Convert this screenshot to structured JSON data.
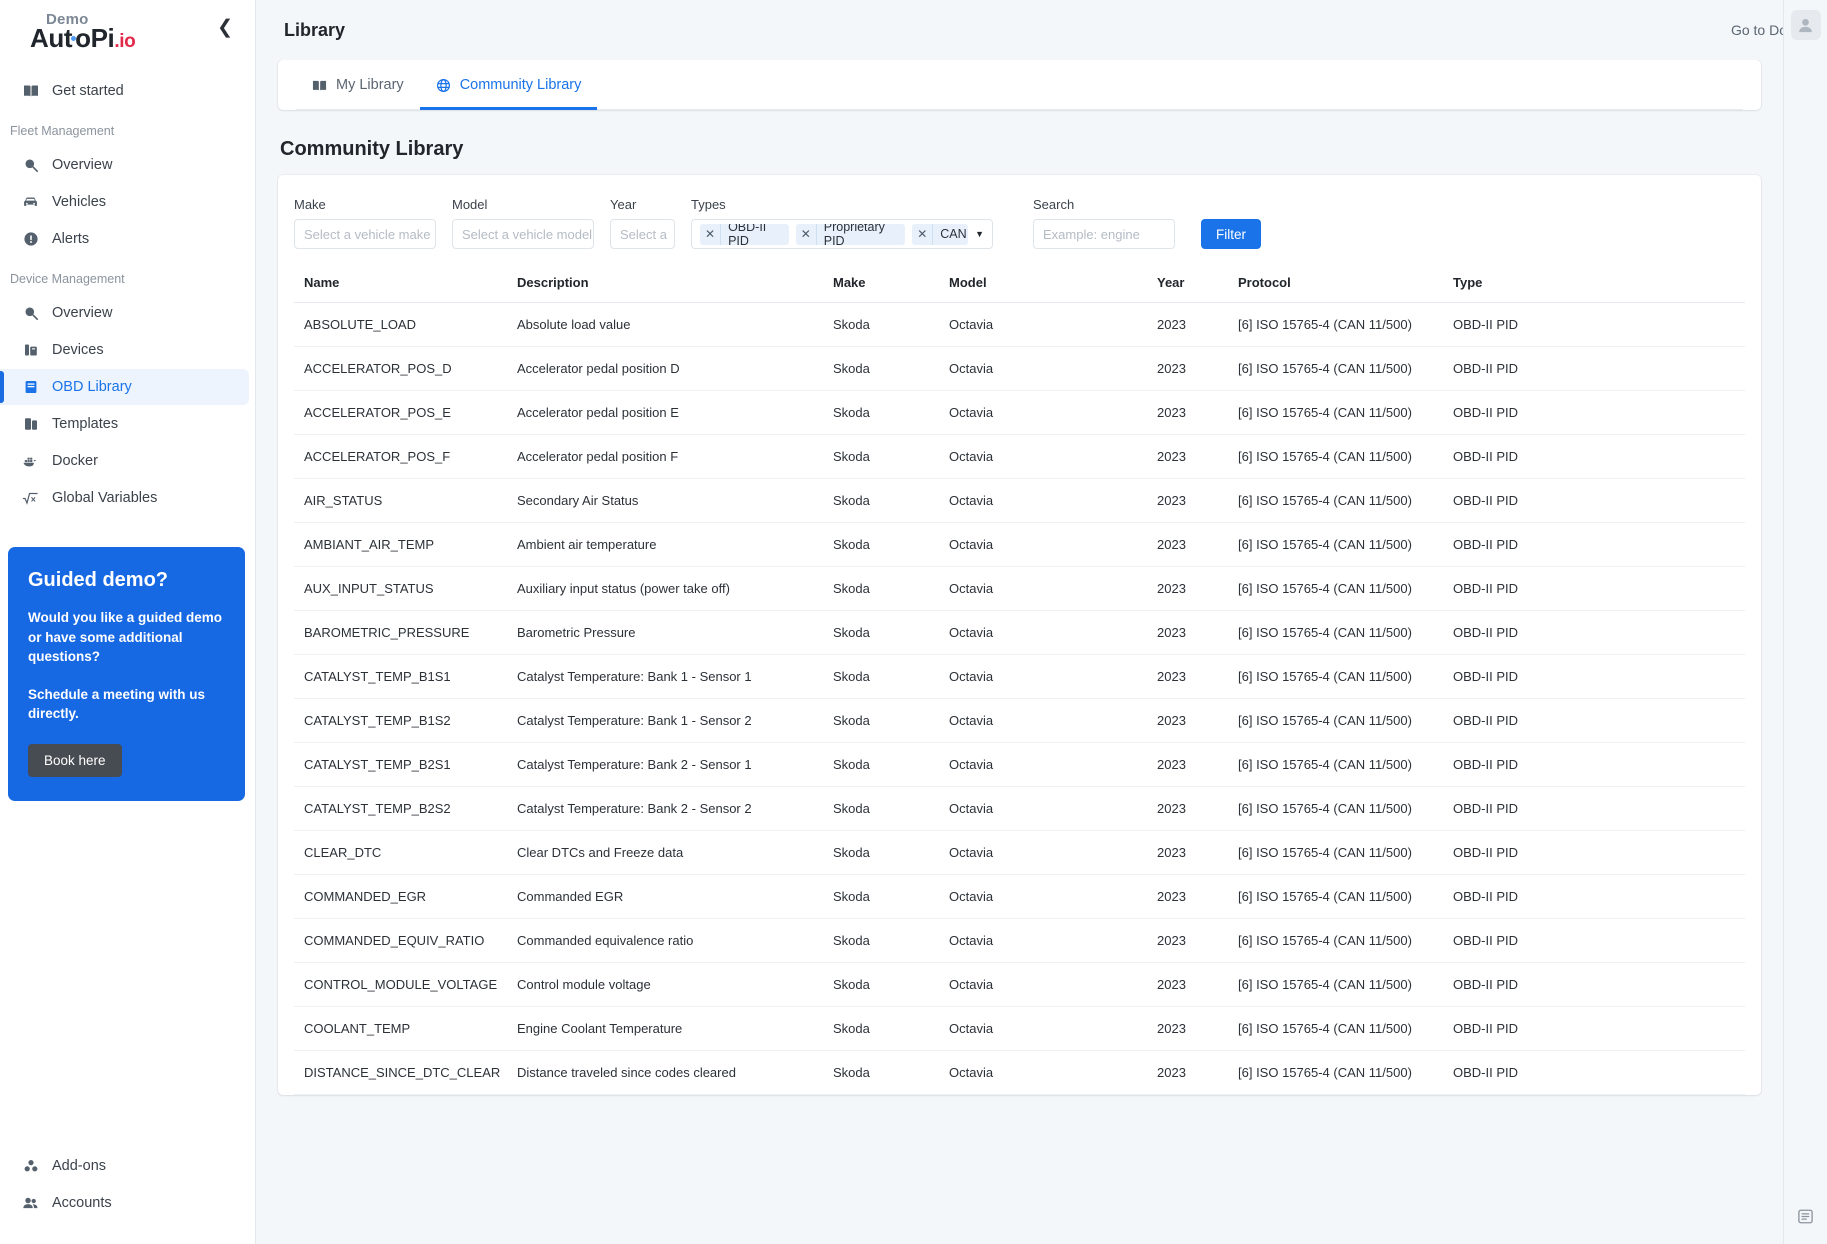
{
  "sidebar": {
    "brand": {
      "demo": "Demo",
      "name": "AutoPi",
      "suffix": ".io"
    },
    "collapse_icon": "chevron-left-icon",
    "top_items": [
      {
        "label": "Get started",
        "icon": "book-icon"
      }
    ],
    "sections": [
      {
        "label": "Fleet Management",
        "items": [
          {
            "label": "Overview",
            "icon": "search-dashboard-icon"
          },
          {
            "label": "Vehicles",
            "icon": "car-icon"
          },
          {
            "label": "Alerts",
            "icon": "exclamation-circle-icon"
          }
        ]
      },
      {
        "label": "Device Management",
        "items": [
          {
            "label": "Overview",
            "icon": "search-dashboard-icon",
            "active": false
          },
          {
            "label": "Devices",
            "icon": "device-icon",
            "active": false
          },
          {
            "label": "OBD Library",
            "icon": "book-blue-icon",
            "active": true
          },
          {
            "label": "Templates",
            "icon": "templates-icon",
            "active": false
          },
          {
            "label": "Docker",
            "icon": "docker-icon",
            "active": false
          },
          {
            "label": "Global Variables",
            "icon": "sqrt-x-icon",
            "active": false
          }
        ]
      }
    ],
    "promo": {
      "title": "Guided demo?",
      "body1": "Would you like a guided demo or have some additional questions?",
      "body2": "Schedule a meeting with us directly.",
      "button": "Book here",
      "bg_color": "#1668e3"
    },
    "bottom_items": [
      {
        "label": "Add-ons",
        "icon": "addons-icon"
      },
      {
        "label": "Accounts",
        "icon": "users-icon"
      }
    ]
  },
  "header": {
    "title": "Library",
    "docs_link": "Go to Docs",
    "avatar_icon": "user-avatar-icon",
    "rail_bottom_icon": "list-icon"
  },
  "tabs": [
    {
      "label": "My Library",
      "icon": "book-open-icon",
      "active": false
    },
    {
      "label": "Community Library",
      "icon": "globe-icon",
      "active": true
    }
  ],
  "section": {
    "title": "Community Library"
  },
  "filters": {
    "make": {
      "label": "Make",
      "placeholder": "Select a vehicle make",
      "value": ""
    },
    "model": {
      "label": "Model",
      "placeholder": "Select a vehicle model",
      "value": ""
    },
    "year": {
      "label": "Year",
      "placeholder": "Select a",
      "value": ""
    },
    "types": {
      "label": "Types",
      "tags": [
        "OBD-II PID",
        "Proprietary PID",
        "CAN"
      ],
      "remove_icon": "close-icon"
    },
    "search": {
      "label": "Search",
      "placeholder": "Example: engine",
      "value": ""
    },
    "filter_button": {
      "label": "Filter",
      "color": "#1a73e8"
    }
  },
  "table": {
    "columns": [
      "Name",
      "Description",
      "Make",
      "Model",
      "Year",
      "Protocol",
      "Type"
    ],
    "rows": [
      [
        "ABSOLUTE_LOAD",
        "Absolute load value",
        "Skoda",
        "Octavia",
        "2023",
        "[6] ISO 15765-4 (CAN 11/500)",
        "OBD-II PID"
      ],
      [
        "ACCELERATOR_POS_D",
        "Accelerator pedal position D",
        "Skoda",
        "Octavia",
        "2023",
        "[6] ISO 15765-4 (CAN 11/500)",
        "OBD-II PID"
      ],
      [
        "ACCELERATOR_POS_E",
        "Accelerator pedal position E",
        "Skoda",
        "Octavia",
        "2023",
        "[6] ISO 15765-4 (CAN 11/500)",
        "OBD-II PID"
      ],
      [
        "ACCELERATOR_POS_F",
        "Accelerator pedal position F",
        "Skoda",
        "Octavia",
        "2023",
        "[6] ISO 15765-4 (CAN 11/500)",
        "OBD-II PID"
      ],
      [
        "AIR_STATUS",
        "Secondary Air Status",
        "Skoda",
        "Octavia",
        "2023",
        "[6] ISO 15765-4 (CAN 11/500)",
        "OBD-II PID"
      ],
      [
        "AMBIANT_AIR_TEMP",
        "Ambient air temperature",
        "Skoda",
        "Octavia",
        "2023",
        "[6] ISO 15765-4 (CAN 11/500)",
        "OBD-II PID"
      ],
      [
        "AUX_INPUT_STATUS",
        "Auxiliary input status (power take off)",
        "Skoda",
        "Octavia",
        "2023",
        "[6] ISO 15765-4 (CAN 11/500)",
        "OBD-II PID"
      ],
      [
        "BAROMETRIC_PRESSURE",
        "Barometric Pressure",
        "Skoda",
        "Octavia",
        "2023",
        "[6] ISO 15765-4 (CAN 11/500)",
        "OBD-II PID"
      ],
      [
        "CATALYST_TEMP_B1S1",
        "Catalyst Temperature: Bank 1 - Sensor 1",
        "Skoda",
        "Octavia",
        "2023",
        "[6] ISO 15765-4 (CAN 11/500)",
        "OBD-II PID"
      ],
      [
        "CATALYST_TEMP_B1S2",
        "Catalyst Temperature: Bank 1 - Sensor 2",
        "Skoda",
        "Octavia",
        "2023",
        "[6] ISO 15765-4 (CAN 11/500)",
        "OBD-II PID"
      ],
      [
        "CATALYST_TEMP_B2S1",
        "Catalyst Temperature: Bank 2 - Sensor 1",
        "Skoda",
        "Octavia",
        "2023",
        "[6] ISO 15765-4 (CAN 11/500)",
        "OBD-II PID"
      ],
      [
        "CATALYST_TEMP_B2S2",
        "Catalyst Temperature: Bank 2 - Sensor 2",
        "Skoda",
        "Octavia",
        "2023",
        "[6] ISO 15765-4 (CAN 11/500)",
        "OBD-II PID"
      ],
      [
        "CLEAR_DTC",
        "Clear DTCs and Freeze data",
        "Skoda",
        "Octavia",
        "2023",
        "[6] ISO 15765-4 (CAN 11/500)",
        "OBD-II PID"
      ],
      [
        "COMMANDED_EGR",
        "Commanded EGR",
        "Skoda",
        "Octavia",
        "2023",
        "[6] ISO 15765-4 (CAN 11/500)",
        "OBD-II PID"
      ],
      [
        "COMMANDED_EQUIV_RATIO",
        "Commanded equivalence ratio",
        "Skoda",
        "Octavia",
        "2023",
        "[6] ISO 15765-4 (CAN 11/500)",
        "OBD-II PID"
      ],
      [
        "CONTROL_MODULE_VOLTAGE",
        "Control module voltage",
        "Skoda",
        "Octavia",
        "2023",
        "[6] ISO 15765-4 (CAN 11/500)",
        "OBD-II PID"
      ],
      [
        "COOLANT_TEMP",
        "Engine Coolant Temperature",
        "Skoda",
        "Octavia",
        "2023",
        "[6] ISO 15765-4 (CAN 11/500)",
        "OBD-II PID"
      ],
      [
        "DISTANCE_SINCE_DTC_CLEAR",
        "Distance traveled since codes cleared",
        "Skoda",
        "Octavia",
        "2023",
        "[6] ISO 15765-4 (CAN 11/500)",
        "OBD-II PID"
      ]
    ]
  }
}
